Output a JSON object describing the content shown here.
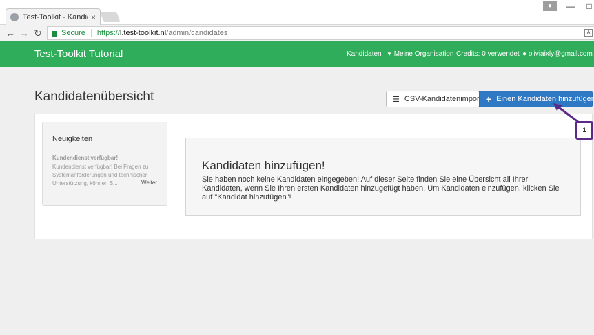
{
  "browser": {
    "tab_title": "Test-Toolkit - Kandidaten",
    "tab_close": "×",
    "secure_label": "Secure",
    "url_scheme": "https://",
    "url_host": "l.test-toolkit.nl",
    "url_path": "/admin/candidates"
  },
  "navbar": {
    "brand": "Test-Toolkit Tutorial",
    "candidates": "Kandidaten",
    "organisation": "Meine Organisation",
    "credits": "Credits: 0 verwendet",
    "user_email": "oliviaixly@gmail.com",
    "color": "#2fad5a"
  },
  "page": {
    "title": "Kandidatenübersicht",
    "import_button": "CSV-Kandidatenimport",
    "add_button": "Einen Kandidaten hinzufügen"
  },
  "news": {
    "heading": "Neuigkeiten",
    "item_title": "Kundendienst verfügbar!",
    "item_text": "Kundendienst verfügbar! Bei Fragen zu Systemanforderungen und technischer Unterstützung, können S...",
    "more": "Weiter"
  },
  "welcome": {
    "title": "Kandidaten hinzufügen!",
    "text": "Sie haben noch keine Kandidaten eingegeben! Auf dieser Seite finden Sie eine Übersicht all Ihrer Kandidaten, wenn Sie Ihren ersten Kandidaten hinzugefügt haben. Um Kandidaten einzufügen, klicken Sie auf \"Kandidat hinzufügen\"!"
  },
  "annotation": {
    "step": "1",
    "color": "#5b2a86"
  }
}
